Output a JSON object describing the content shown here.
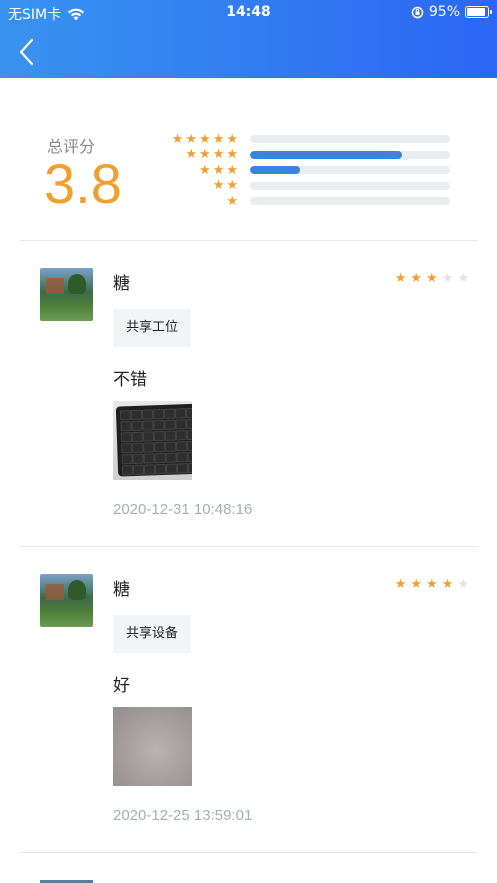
{
  "status_bar": {
    "carrier": "无SIM卡",
    "time": "14:48",
    "battery": "95%",
    "battery_level": 0.95
  },
  "header": {
    "back_icon": "chevron-left-icon"
  },
  "summary": {
    "label": "总评分",
    "score": "3.8",
    "distribution": [
      {
        "stars": 5,
        "fraction": 0.0
      },
      {
        "stars": 4,
        "fraction": 0.76
      },
      {
        "stars": 3,
        "fraction": 0.25
      },
      {
        "stars": 2,
        "fraction": 0.0
      },
      {
        "stars": 1,
        "fraction": 0.0
      }
    ]
  },
  "reviews": [
    {
      "name": "糖",
      "rating": 3,
      "tag": "共享工位",
      "comment": "不错",
      "photo": "keyboard-photo",
      "time": "2020-12-31 10:48:16"
    },
    {
      "name": "糖",
      "rating": 4,
      "tag": "共享设备",
      "comment": "好",
      "photo": "blurred-photo",
      "time": "2020-12-25 13:59:01"
    }
  ],
  "colors": {
    "header_start": "#3a93f0",
    "header_end": "#2b66f4",
    "score": "#f0a030",
    "star": "#f0a030",
    "bar_fill": "#3a84e0"
  }
}
